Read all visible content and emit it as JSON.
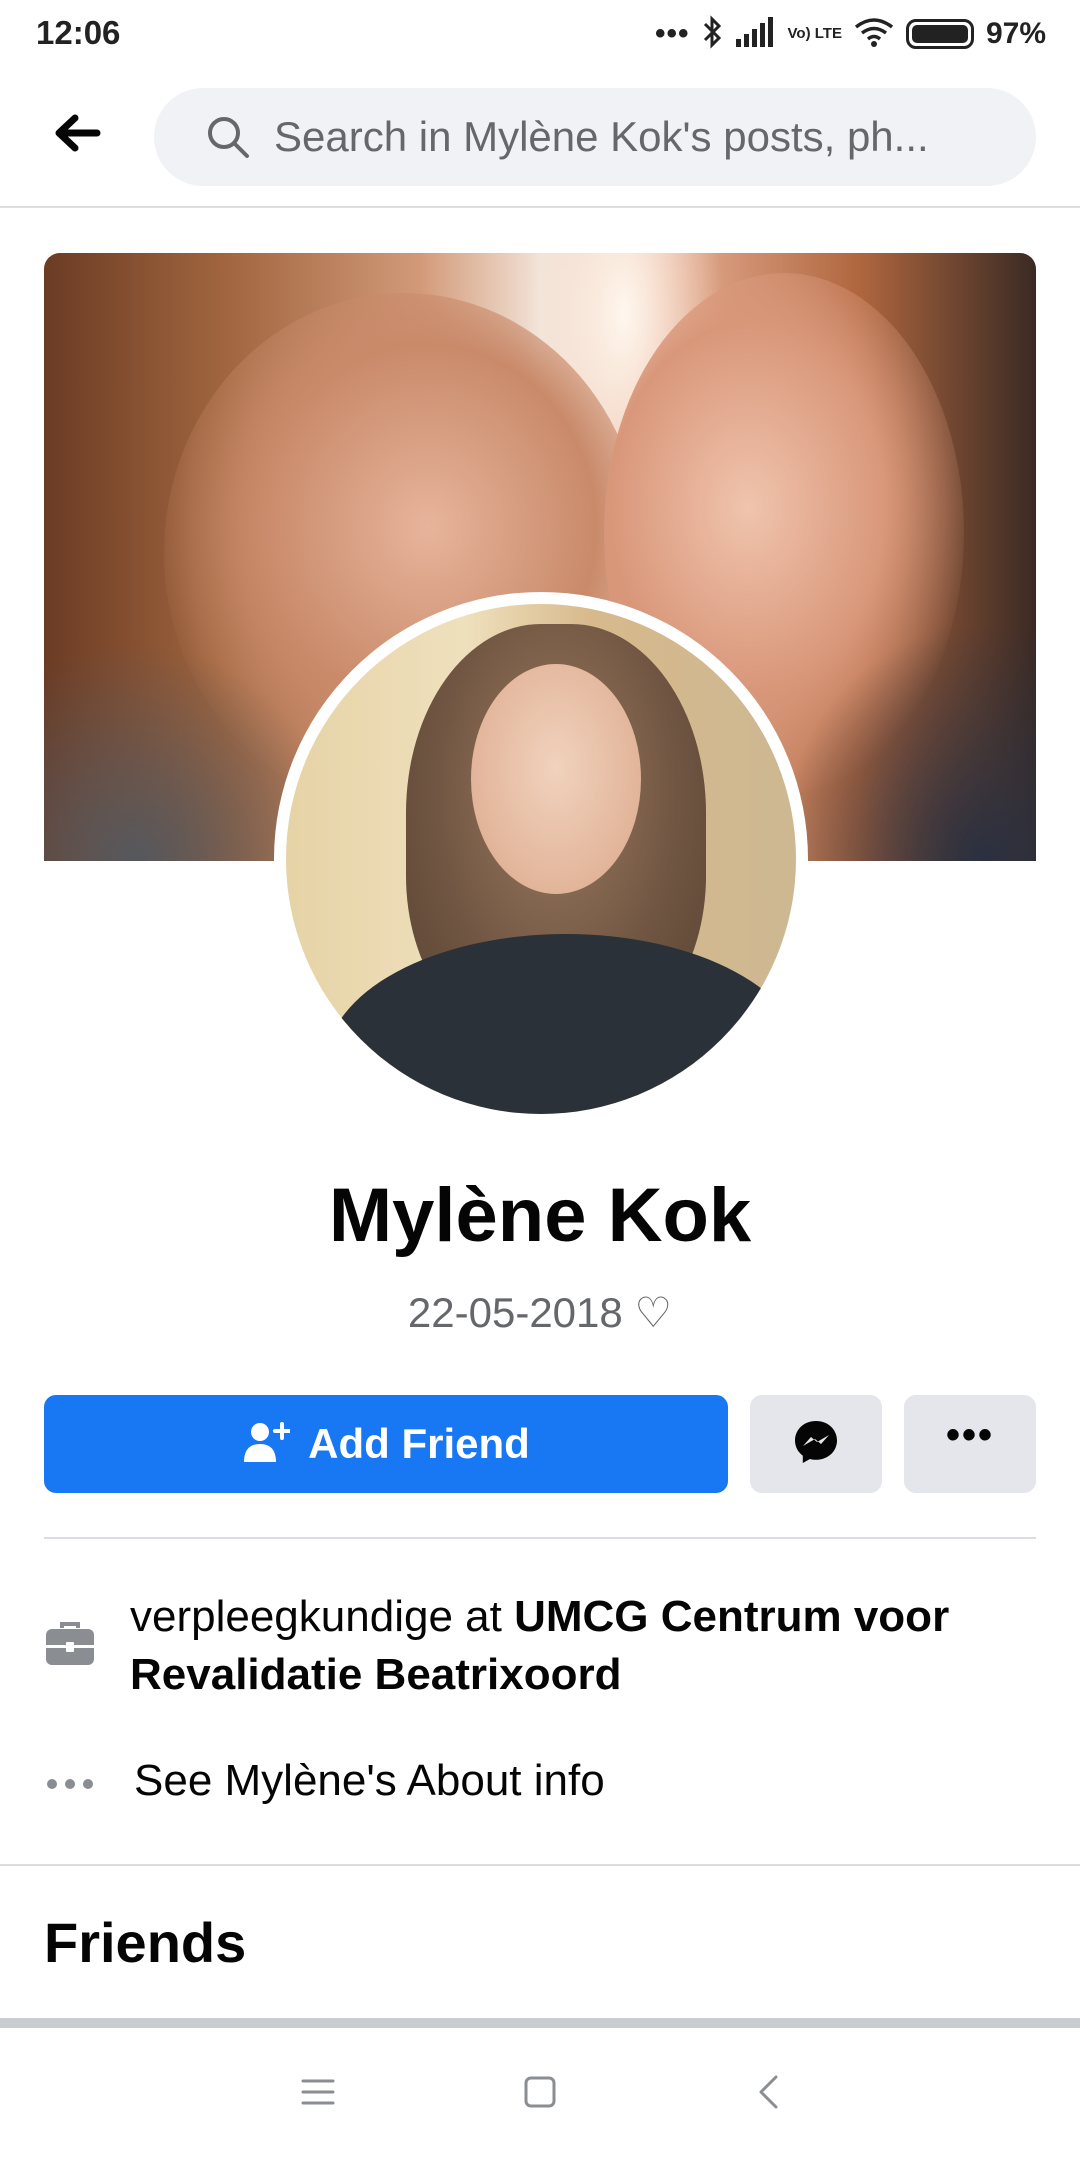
{
  "status_bar": {
    "time": "12:06",
    "dots": "•••",
    "lte_label": "Vo) LTE",
    "battery_percent": "97%"
  },
  "search": {
    "placeholder": "Search in Mylène Kok's posts, ph..."
  },
  "profile": {
    "name": "Mylène Kok",
    "bio": "22-05-2018 ♡"
  },
  "actions": {
    "add_friend_label": "Add Friend",
    "messenger_icon": "messenger-icon",
    "more_label": "•••"
  },
  "intro": {
    "work_prefix": "verpleegkundige at ",
    "work_employer": "UMCG Centrum voor Revalidatie Beatrixoord",
    "about_link": "See Mylène's About info"
  },
  "friends": {
    "title": "Friends"
  },
  "colors": {
    "accent": "#1877f2",
    "secondary_button": "#e4e6eb",
    "text_secondary": "#65676b"
  },
  "icons": {
    "back": "arrow-left-icon",
    "search": "search-icon",
    "add_friend": "person-plus-icon",
    "work": "briefcase-icon",
    "about": "more-horizontal-icon",
    "nav_menu": "menu-icon",
    "nav_home": "square-home-icon",
    "nav_back": "chevron-left-icon"
  }
}
